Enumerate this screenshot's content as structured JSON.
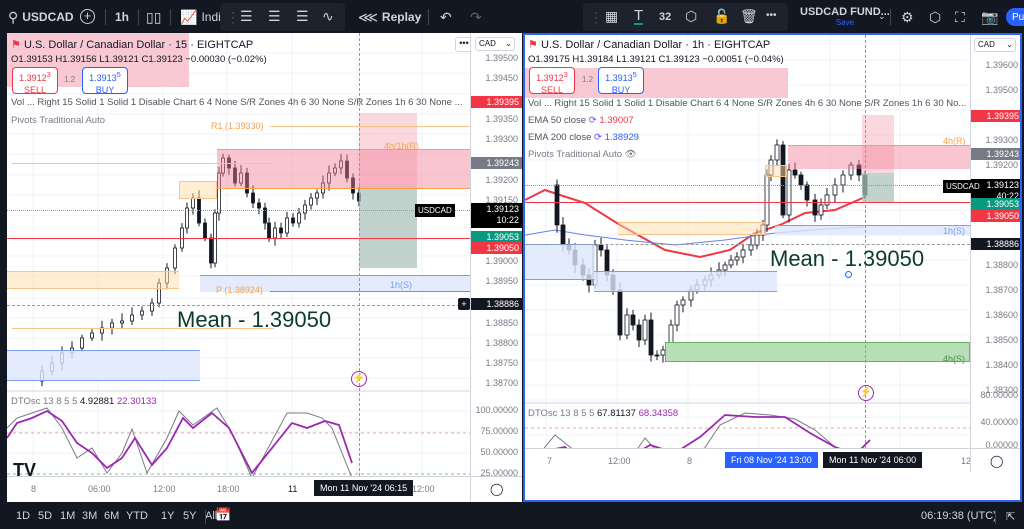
{
  "topbar": {
    "symbol": "USDCAD",
    "interval": "1h",
    "indicators_label": "Indic",
    "replay_label": "Replay",
    "text_size": "32",
    "layout_name": "USDCAD FUND...",
    "save_label": "Save",
    "publish_label": "Pu",
    "icons": [
      "search-icon",
      "add-symbol-icon",
      "candles-icon",
      "indicators-icon",
      "drag-handle-icon",
      "template-icon-1",
      "template-icon-2",
      "template-icon-3",
      "trend-icon",
      "replay-icon",
      "chevron-down-icon",
      "undo-icon",
      "redo-icon",
      "object-tree-icon",
      "text-tool-icon",
      "settings-hex-icon",
      "unlock-icon",
      "trash-icon",
      "more-icon",
      "alert-icon",
      "settings-icon",
      "fullscreen-icon",
      "camera-icon"
    ]
  },
  "left_chart": {
    "title": "U.S. Dollar / Canadian Dollar · 15 · EIGHTCAP",
    "ohlc": {
      "o": "1.39153",
      "h": "1.39156",
      "l": "1.39121",
      "c": "1.39123",
      "change": "−0.00030 (−0.02%)"
    },
    "sell": {
      "price": "1.3912",
      "sup": "3",
      "label": "SELL"
    },
    "spread": "1.2",
    "buy": {
      "price": "1.3913",
      "sup": "5",
      "label": "BUY"
    },
    "indicator_line": "Vol ...  Right 15 Solid 1 Solid 1 Disable Chart 6 4 None S/R Zones 4h 6 30 None S/R Zones 1h 6 30 None ...",
    "pivots_label": "Pivots Traditional Auto",
    "currency": "CAD",
    "price_axis": [
      "1.39500",
      "1.39450",
      "1.39350",
      "1.39300",
      "1.39200",
      "1.39150",
      "1.39000",
      "1.38950",
      "1.38850",
      "1.38800",
      "1.38750",
      "1.38700"
    ],
    "price_tags": {
      "red_top": "1.39395",
      "grey": "1.39243",
      "current": "1.39123",
      "countdown": "10:22",
      "green": "1.39053",
      "red": "1.39050",
      "crosshair": "1.38886"
    },
    "symbol_tag": "USDCAD",
    "labels": {
      "r1": "R1 (1.39330)",
      "p": "P (1.38924)",
      "zone_r": "4h/1h(R)",
      "zone_s": "1h(S)"
    },
    "mean_text": "Mean - 1.39050",
    "oscillator": {
      "name": "DTOsc 13 8 5 5",
      "v1": "4.92881",
      "v2": "22.30133",
      "axis": [
        "100.00000",
        "75.00000",
        "50.00000",
        "25.00000"
      ]
    },
    "time_axis": [
      "8",
      "06:00",
      "12:00",
      "18:00",
      "11",
      "12:00"
    ],
    "time_cursor": "Mon 11 Nov '24   06:15"
  },
  "right_chart": {
    "title": "U.S. Dollar / Canadian Dollar · 1h · EIGHTCAP",
    "ohlc": {
      "o": "1.39175",
      "h": "1.39184",
      "l": "1.39121",
      "c": "1.39123",
      "change": "−0.00051 (−0.04%)"
    },
    "sell": {
      "price": "1.3912",
      "sup": "3",
      "label": "SELL"
    },
    "spread": "1.2",
    "buy": {
      "price": "1.3913",
      "sup": "5",
      "label": "BUY"
    },
    "indicator_line": "Vol ...  Right 15 Solid 1 Solid 1 Disable Chart 6 4 None S/R Zones 4h 6 30 None S/R Zones 1h 6 30 No...",
    "ema50": {
      "label": "EMA 50 close",
      "value": "1.39007",
      "color": "#f23645"
    },
    "ema200": {
      "label": "EMA 200 close",
      "value": "1.38929",
      "color": "#2962ff"
    },
    "pivots_label": "Pivots Traditional Auto",
    "currency": "CAD",
    "price_axis": [
      "1.39600",
      "1.39500",
      "1.39300",
      "1.39200",
      "1.38800",
      "1.38700",
      "1.38600",
      "1.38500",
      "1.38400",
      "1.38300"
    ],
    "price_tags": {
      "red_top": "1.39395",
      "grey": "1.39243",
      "current": "1.39123",
      "countdown": "40:22",
      "green": "1.39053",
      "red": "1.39050",
      "crosshair": "1.38886"
    },
    "symbol_tag": "USDCAD",
    "labels": {
      "zone_r": "4h(R)",
      "zone_s1": "1h(S)",
      "zone_s2": "4h(S)"
    },
    "mean_text": "Mean - 1.39050",
    "oscillator": {
      "name": "DTOsc 13 8 5 5",
      "v1": "67.81137",
      "v2": "68.34358",
      "axis": [
        "80.00000",
        "40.00000",
        "0.00000"
      ]
    },
    "time_axis": [
      "7",
      "12:00",
      "8",
      "12"
    ],
    "time_highlight": "Fri 08 Nov '24   13:00",
    "time_cursor": "Mon 11 Nov '24   06:00"
  },
  "bottombar": {
    "ranges": [
      "1D",
      "5D",
      "1M",
      "3M",
      "6M",
      "YTD",
      "1Y",
      "5Y",
      "All"
    ],
    "clock": "06:19:38 (UTC)"
  },
  "colors": {
    "accent": "#2962ff",
    "sell": "#f23645",
    "buy": "#089981",
    "osc_main": "#9c27b0",
    "zone_r": "#f7a9b6",
    "zone_s": "#dde6fb",
    "zone_s4h": "#b7dfb5"
  }
}
